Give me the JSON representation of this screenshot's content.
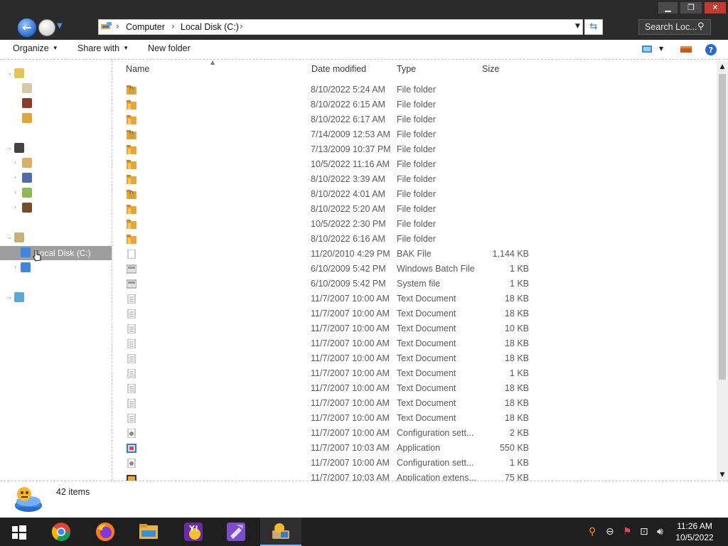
{
  "window": {
    "minimize": "▁",
    "maximize": "❐",
    "close": "✕"
  },
  "address": {
    "crumbs": [
      "Computer",
      "Local Disk (C:)"
    ],
    "search_placeholder": "Search Loc..."
  },
  "toolbar": {
    "organize": "Organize",
    "share_with": "Share with",
    "new_folder": "New folder"
  },
  "nav": {
    "items": [
      {
        "label": "",
        "icon": "star-icon"
      },
      {
        "label": "",
        "icon": "desktop-icon"
      },
      {
        "label": "",
        "icon": "downloads-icon"
      },
      {
        "label": "",
        "icon": "recent-places-icon"
      },
      {
        "label": "",
        "icon": "libraries-icon"
      },
      {
        "label": "",
        "icon": "documents-icon"
      },
      {
        "label": "",
        "icon": "music-icon"
      },
      {
        "label": "",
        "icon": "pictures-icon"
      },
      {
        "label": "",
        "icon": "videos-icon"
      },
      {
        "label": "",
        "icon": "computer-icon"
      },
      {
        "label": "Local Disk (C:)",
        "icon": "drive-icon",
        "selected": true
      },
      {
        "label": "",
        "icon": "drive-icon"
      },
      {
        "label": "",
        "icon": "network-icon"
      }
    ]
  },
  "columns": {
    "name": "Name",
    "date": "Date modified",
    "type": "Type",
    "size": "Size"
  },
  "files": [
    {
      "name": "",
      "date": "8/10/2022 5:24 AM",
      "type": "File folder",
      "size": "",
      "kind": "locked-folder"
    },
    {
      "name": "",
      "date": "8/10/2022 6:15 AM",
      "type": "File folder",
      "size": "",
      "kind": "folder"
    },
    {
      "name": "",
      "date": "8/10/2022 6:17 AM",
      "type": "File folder",
      "size": "",
      "kind": "folder"
    },
    {
      "name": "",
      "date": "7/14/2009 12:53 AM",
      "type": "File folder",
      "size": "",
      "kind": "locked-folder"
    },
    {
      "name": "",
      "date": "7/13/2009 10:37 PM",
      "type": "File folder",
      "size": "",
      "kind": "folder"
    },
    {
      "name": "",
      "date": "10/5/2022 11:16 AM",
      "type": "File folder",
      "size": "",
      "kind": "folder"
    },
    {
      "name": "",
      "date": "8/10/2022 3:39 AM",
      "type": "File folder",
      "size": "",
      "kind": "folder"
    },
    {
      "name": "",
      "date": "8/10/2022 4:01 AM",
      "type": "File folder",
      "size": "",
      "kind": "locked-folder"
    },
    {
      "name": "",
      "date": "8/10/2022 5:20 AM",
      "type": "File folder",
      "size": "",
      "kind": "folder"
    },
    {
      "name": "",
      "date": "10/5/2022 2:30 PM",
      "type": "File folder",
      "size": "",
      "kind": "folder"
    },
    {
      "name": "",
      "date": "8/10/2022 6:16 AM",
      "type": "File folder",
      "size": "",
      "kind": "folder"
    },
    {
      "name": "",
      "date": "11/20/2010 4:29 PM",
      "type": "BAK File",
      "size": "1,144 KB",
      "kind": "file"
    },
    {
      "name": "",
      "date": "6/10/2009 5:42 PM",
      "type": "Windows Batch File",
      "size": "1 KB",
      "kind": "batch"
    },
    {
      "name": "",
      "date": "6/10/2009 5:42 PM",
      "type": "System file",
      "size": "1 KB",
      "kind": "batch"
    },
    {
      "name": "",
      "date": "11/7/2007 10:00 AM",
      "type": "Text Document",
      "size": "18 KB",
      "kind": "text"
    },
    {
      "name": "",
      "date": "11/7/2007 10:00 AM",
      "type": "Text Document",
      "size": "18 KB",
      "kind": "text"
    },
    {
      "name": "",
      "date": "11/7/2007 10:00 AM",
      "type": "Text Document",
      "size": "10 KB",
      "kind": "text"
    },
    {
      "name": "",
      "date": "11/7/2007 10:00 AM",
      "type": "Text Document",
      "size": "18 KB",
      "kind": "text"
    },
    {
      "name": "",
      "date": "11/7/2007 10:00 AM",
      "type": "Text Document",
      "size": "18 KB",
      "kind": "text"
    },
    {
      "name": "",
      "date": "11/7/2007 10:00 AM",
      "type": "Text Document",
      "size": "1 KB",
      "kind": "text"
    },
    {
      "name": "",
      "date": "11/7/2007 10:00 AM",
      "type": "Text Document",
      "size": "18 KB",
      "kind": "text"
    },
    {
      "name": "",
      "date": "11/7/2007 10:00 AM",
      "type": "Text Document",
      "size": "18 KB",
      "kind": "text"
    },
    {
      "name": "",
      "date": "11/7/2007 10:00 AM",
      "type": "Text Document",
      "size": "18 KB",
      "kind": "text"
    },
    {
      "name": "",
      "date": "11/7/2007 10:00 AM",
      "type": "Configuration sett...",
      "size": "2 KB",
      "kind": "config"
    },
    {
      "name": "",
      "date": "11/7/2007 10:03 AM",
      "type": "Application",
      "size": "550 KB",
      "kind": "app"
    },
    {
      "name": "",
      "date": "11/7/2007 10:00 AM",
      "type": "Configuration sett...",
      "size": "1 KB",
      "kind": "config"
    },
    {
      "name": "",
      "date": "11/7/2007 10:03 AM",
      "type": "Application extens...",
      "size": "75 KB",
      "kind": "dll"
    }
  ],
  "status": {
    "item_count": "42 items"
  },
  "taskbar": {
    "apps": [
      "start-icon",
      "chrome-icon",
      "firefox-icon",
      "file-explorer-icon",
      "yahoo-messenger-icon",
      "visual-studio-icon",
      "drive-manager-icon"
    ],
    "clock_time": "11:26 AM",
    "clock_date": "10/5/2022"
  },
  "colors": {
    "folder": "#e8a53a",
    "selection": "#9e9e9e",
    "accent": "#2a6ac8"
  }
}
